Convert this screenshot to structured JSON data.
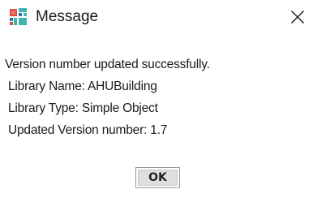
{
  "window": {
    "title": "Message",
    "icons": {
      "app": "app-logo-icon",
      "close": "close-icon"
    }
  },
  "message": {
    "lines": [
      "Version number updated successfully.",
      "Library Name: AHUBuilding",
      "Library Type: Simple Object",
      "Updated Version number: 1.7"
    ]
  },
  "buttons": {
    "ok_label": "OK"
  },
  "colors": {
    "background": "#ffffff",
    "logo_red": "#e04b37",
    "logo_teal": "#3fb6b0",
    "logo_blue": "#2f6fb5",
    "button_face": "#dedede"
  }
}
